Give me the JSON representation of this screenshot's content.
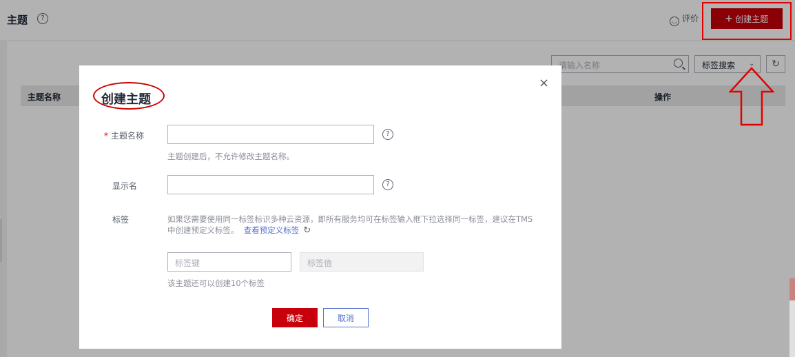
{
  "page": {
    "title": "主题",
    "feedback": "评价",
    "create_button": "创建主题"
  },
  "toolbar": {
    "search_placeholder": "请输入名称",
    "tag_search": "标签搜索"
  },
  "table": {
    "col_name": "主题名称",
    "col_action": "操作"
  },
  "modal": {
    "title": "创建主题",
    "close": "×",
    "topic_name_label": "主题名称",
    "topic_name_hint": "主题创建后，不允许修改主题名称。",
    "display_name_label": "显示名",
    "tag_label": "标签",
    "tag_hint": "如果您需要使用同一标签标识多种云资源，即所有服务均可在标签输入框下拉选择同一标签，建议在TMS中创建预定义标签。",
    "tag_link": "查看预定义标签",
    "tag_key_placeholder": "标签键",
    "tag_value_placeholder": "标签值",
    "tag_remaining": "该主题还可以创建10个标签",
    "ok": "确定",
    "cancel": "取消"
  },
  "colors": {
    "primary": "#c7000b",
    "link": "#526ecc",
    "annotation": "#e30000"
  }
}
